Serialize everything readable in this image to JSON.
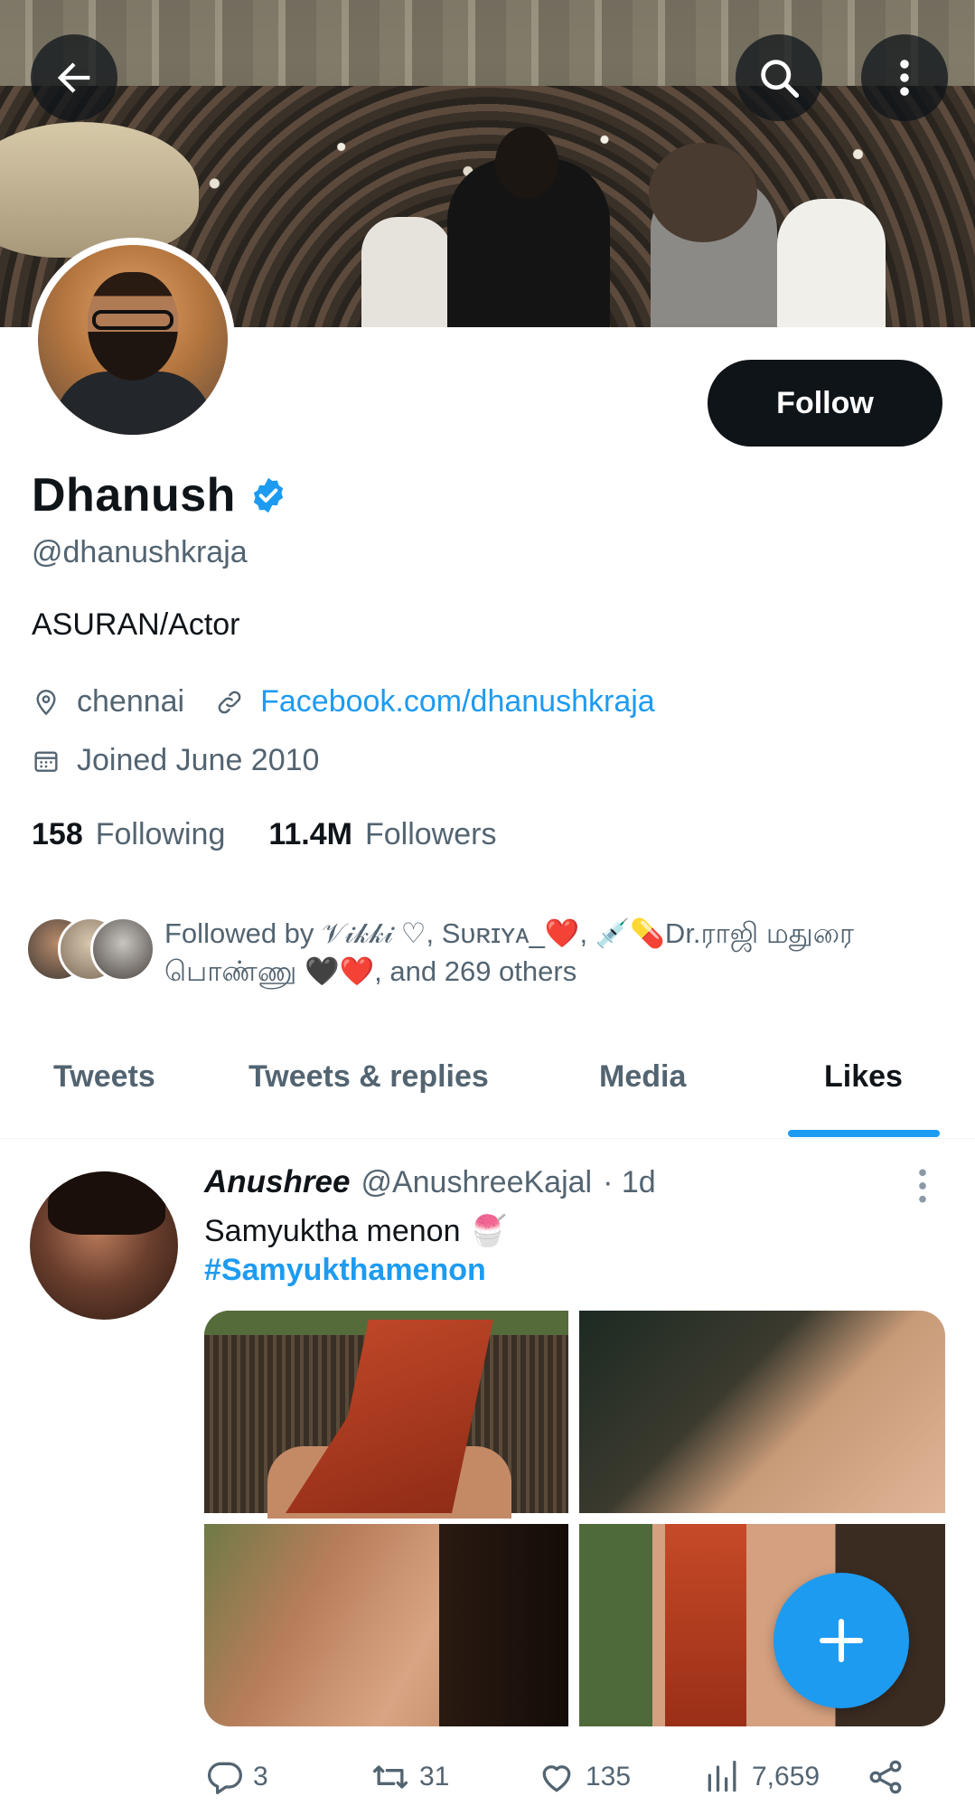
{
  "header": {
    "back_label": "Back",
    "search_label": "Search",
    "more_label": "More options"
  },
  "profile": {
    "follow_label": "Follow",
    "name": "Dhanush",
    "handle": "@dhanushkraja",
    "bio": "ASURAN/Actor",
    "location": "chennai",
    "website": "Facebook.com/dhanushkraja",
    "joined": "Joined June 2010",
    "following_count": "158",
    "following_label": "Following",
    "followers_count": "11.4M",
    "followers_label": "Followers",
    "followed_by_prefix": "Followed by",
    "followed_by_1": "𝒱𝒾𝓀𝓀𝒾 ♡,",
    "followed_by_2": "Sᴜʀɪʏᴀ_❤️,",
    "followed_by_3": "💉💊Dr.ராஜி மதுரை பொண்ணு 🖤❤️,",
    "followed_by_suffix": "and 269 others"
  },
  "tabs": [
    {
      "label": "Tweets",
      "active": false
    },
    {
      "label": "Tweets & replies",
      "active": false
    },
    {
      "label": "Media",
      "active": false
    },
    {
      "label": "Likes",
      "active": true
    }
  ],
  "tweet": {
    "author": "Anushree",
    "handle": "@AnushreeKajal",
    "time": "· 1d",
    "text": "Samyuktha menon 🍧",
    "hashtag": "#Samyukthamenon",
    "replies": "3",
    "retweets": "31",
    "likes": "135",
    "views": "7,659"
  },
  "colors": {
    "accent": "#1d9bf0",
    "text_primary": "#0f1419",
    "text_secondary": "#536471",
    "button_dark": "#0f1419"
  }
}
